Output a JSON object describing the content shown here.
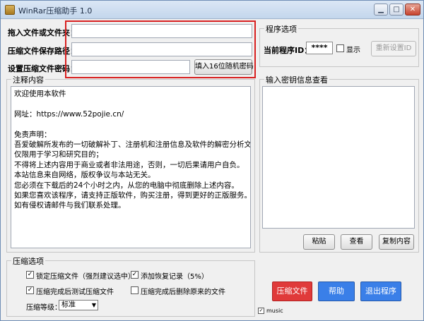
{
  "titlebar": {
    "title": "WinRar压缩助手 1.0",
    "minimize_icon": "minimize-icon",
    "maximize_icon": "maximize-icon",
    "close_icon": "close-icon",
    "minimize_glyph": "▁",
    "maximize_glyph": "□",
    "close_glyph": "✕"
  },
  "form": {
    "drag_label": "拖入文件或文件夹：",
    "save_path_label": "压缩文件保存路径：",
    "password_label": "设置压缩文件密码：",
    "drag_value": "",
    "save_path_value": "",
    "password_value": "",
    "random_password_button": "填入16位随机密码"
  },
  "program_options": {
    "title": "程序选项",
    "current_id_label": "当前程序ID：",
    "current_id_value": "****",
    "show_label": "显示",
    "show_checked": false,
    "reset_id_button": "重新设置ID"
  },
  "notes": {
    "title": "注释内容",
    "lines": [
      "欢迎使用本软件",
      "",
      "网址：https://www.52pojie.cn/",
      "",
      "免责声明：",
      "吾爱破解所发布的一切破解补丁、注册机和注册信息及软件的解密分析文章",
      "仅限用于学习和研究目的；",
      "不得将上述内容用于商业或者非法用途，否则，一切后果请用户自负。",
      "本站信息来自网络，版权争议与本站无关。",
      "您必须在下载后的24个小时之内，从您的电脑中彻底删除上述内容。",
      "如果您喜欢该程序，请支持正版软件，购买注册，得到更好的正版服务。",
      "如有侵权请邮件与我们联系处理。"
    ]
  },
  "password_info": {
    "title": "输入密钥信息查看",
    "content": "",
    "paste_button": "粘贴",
    "view_button": "查看",
    "copy_button": "复制内容"
  },
  "compress_options": {
    "title": "压缩选项",
    "lock_label": "锁定压缩文件（强烈建议选中）",
    "lock_checked": true,
    "recovery_label": "添加恢复记录（5%）",
    "recovery_checked": true,
    "test_label": "压缩完成后测试压缩文件",
    "test_checked": true,
    "delete_label": "压缩完成后删除原来的文件",
    "delete_checked": false,
    "level_label": "压缩等级：",
    "level_value": "标准"
  },
  "actions": {
    "compress_button": "压缩文件",
    "help_button": "帮助",
    "exit_button": "退出程序",
    "compress_color": "#e03a3a",
    "help_color": "#3a7fe8",
    "exit_color": "#3a7fe8"
  },
  "music": {
    "label": "music",
    "checked": true
  },
  "colors": {
    "highlight_border": "#d82020"
  }
}
